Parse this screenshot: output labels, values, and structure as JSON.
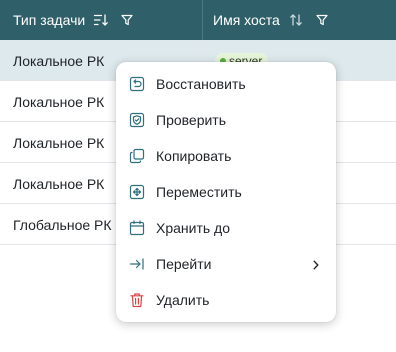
{
  "table": {
    "columns": [
      {
        "label": "Тип задачи",
        "sort_icon": "sort-descending-icon",
        "filter_icon": "filter-icon"
      },
      {
        "label": "Имя хоста",
        "sort_icon": "sort-both-icon",
        "filter_icon": "filter-icon"
      }
    ],
    "rows": [
      {
        "task_type": "Локальное РК",
        "host": "server",
        "selected": true
      },
      {
        "task_type": "Локальное РК"
      },
      {
        "task_type": "Локальное РК"
      },
      {
        "task_type": "Локальное РК"
      },
      {
        "task_type": "Глобальное РК"
      }
    ],
    "tag_color": "#58b03a"
  },
  "context_menu": {
    "items": [
      {
        "label": "Восстановить",
        "icon": "restore-icon"
      },
      {
        "label": "Проверить",
        "icon": "check-shield-icon"
      },
      {
        "label": "Копировать",
        "icon": "copy-icon"
      },
      {
        "label": "Переместить",
        "icon": "move-icon"
      },
      {
        "label": "Хранить до",
        "icon": "calendar-icon"
      },
      {
        "label": "Перейти",
        "icon": "goto-icon",
        "submenu": true
      },
      {
        "label": "Удалить",
        "icon": "trash-icon",
        "danger": true
      }
    ],
    "accent_color": "#2f6f7e",
    "danger_color": "#d64545"
  },
  "header_color": "#2f5f68",
  "selected_row_color": "#dde9ed"
}
